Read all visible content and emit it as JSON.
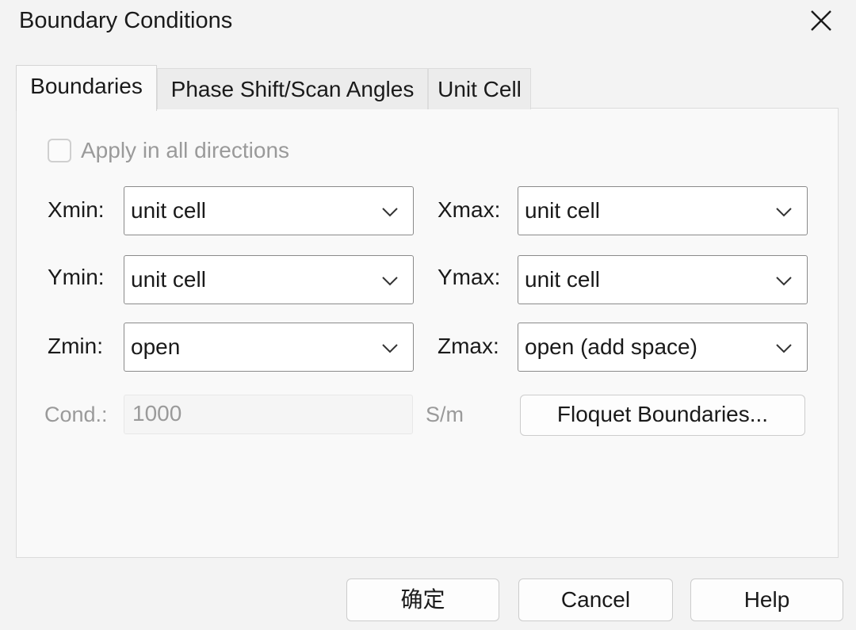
{
  "window": {
    "title": "Boundary Conditions",
    "close_icon": "close-icon"
  },
  "tabs": [
    {
      "label": "Boundaries",
      "active": true
    },
    {
      "label": "Phase Shift/Scan Angles",
      "active": false
    },
    {
      "label": "Unit Cell",
      "active": false
    }
  ],
  "apply_all": {
    "label": "Apply in all directions",
    "checked": false,
    "enabled": false
  },
  "boundaries": {
    "xmin": {
      "label": "Xmin:",
      "value": "unit cell"
    },
    "xmax": {
      "label": "Xmax:",
      "value": "unit cell"
    },
    "ymin": {
      "label": "Ymin:",
      "value": "unit cell"
    },
    "ymax": {
      "label": "Ymax:",
      "value": "unit cell"
    },
    "zmin": {
      "label": "Zmin:",
      "value": "open"
    },
    "zmax": {
      "label": "Zmax:",
      "value": "open (add space)"
    }
  },
  "cond": {
    "label": "Cond.:",
    "value": "1000",
    "unit": "S/m",
    "enabled": false
  },
  "floquet_button": "Floquet Boundaries...",
  "footer": {
    "ok_label": "确定",
    "cancel_label": "Cancel",
    "help_label": "Help"
  }
}
